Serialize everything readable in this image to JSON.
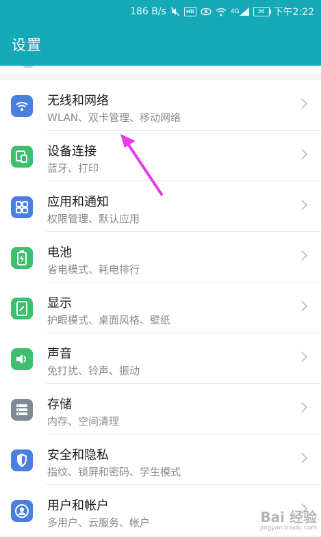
{
  "status_bar": {
    "speed": "186 B/s",
    "hd": "HD",
    "signal_label": "4G",
    "battery": "36",
    "time": "下午2:22"
  },
  "header": {
    "title": "设置"
  },
  "items": [
    {
      "title": "无线和网络",
      "subtitle": "WLAN、双卡管理、移动网络",
      "icon": "wifi-icon",
      "color": "#4a7fe0"
    },
    {
      "title": "设备连接",
      "subtitle": "蓝牙、打印",
      "icon": "device-connection-icon",
      "color": "#3ebf6d"
    },
    {
      "title": "应用和通知",
      "subtitle": "权限管理、默认应用",
      "icon": "apps-grid-icon",
      "color": "#4a7fe0"
    },
    {
      "title": "电池",
      "subtitle": "省电模式、耗电排行",
      "icon": "battery-icon",
      "color": "#3ebf6d"
    },
    {
      "title": "显示",
      "subtitle": "护眼模式、桌面风格、壁纸",
      "icon": "display-icon",
      "color": "#3ebf6d"
    },
    {
      "title": "声音",
      "subtitle": "免打扰、铃声、振动",
      "icon": "sound-icon",
      "color": "#3ebf6d"
    },
    {
      "title": "存储",
      "subtitle": "内存、空间清理",
      "icon": "storage-icon",
      "color": "#808a94"
    },
    {
      "title": "安全和隐私",
      "subtitle": "指纹、锁屏和密码、学生模式",
      "icon": "shield-icon",
      "color": "#4a7fe0"
    },
    {
      "title": "用户和帐户",
      "subtitle": "多用户、云服务、帐户",
      "icon": "user-icon",
      "color": "#4a7fe0"
    }
  ],
  "colors": {
    "accent": "#15a9b7",
    "annotation_arrow": "#e83ae6"
  },
  "watermark": {
    "text": "Bai 经验",
    "sub": "jingyan.baidu.com"
  }
}
